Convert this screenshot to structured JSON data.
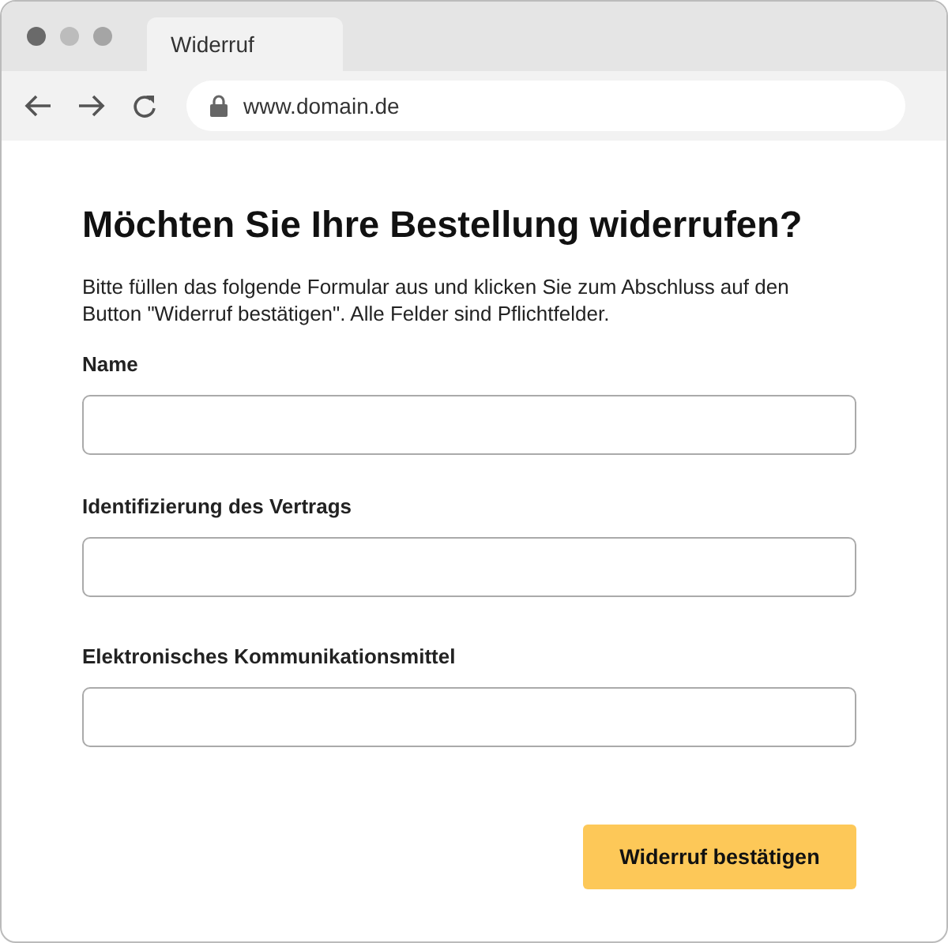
{
  "window": {
    "tab_title": "Widerruf",
    "url": "www.domain.de"
  },
  "heading": "Möchten Sie Ihre Bestellung widerrufen?",
  "intro": "Bitte füllen das folgende Formular aus und klicken Sie zum Abschluss auf den Button \"Widerruf bestätigen\". Alle Felder sind Pflichtfelder.",
  "fields": [
    {
      "label": "Name"
    },
    {
      "label": "Identifizierung des Vertrags"
    },
    {
      "label": "Elektronisches Kommunikationsmittel"
    }
  ],
  "submit_button": "Widerruf bestätigen"
}
